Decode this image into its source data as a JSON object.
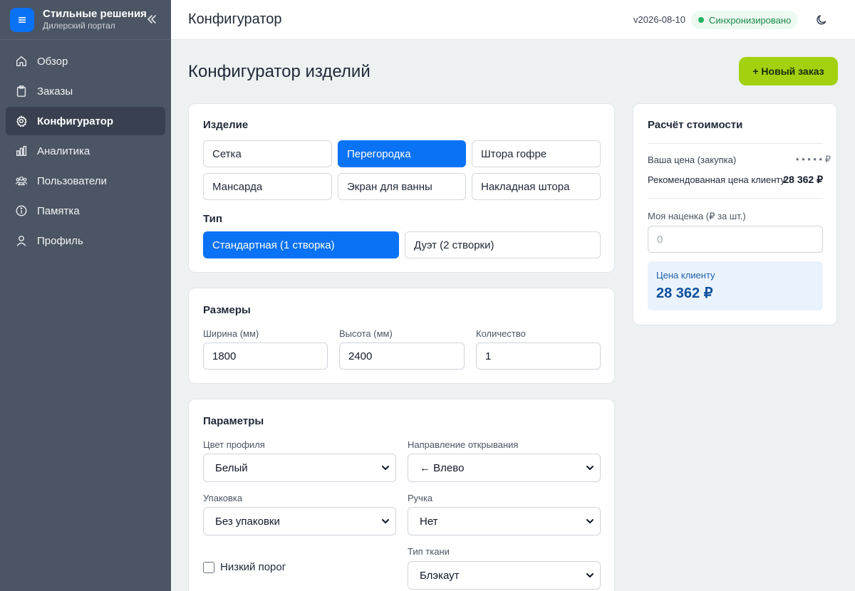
{
  "brand": {
    "name": "Стильные решения",
    "subtitle": "Дилерский портал"
  },
  "sidebar": {
    "items": [
      {
        "label": "Обзор",
        "icon": "home-icon",
        "active": false
      },
      {
        "label": "Заказы",
        "icon": "clipboard-icon",
        "active": false
      },
      {
        "label": "Конфигуратор",
        "icon": "gear-icon",
        "active": true
      },
      {
        "label": "Аналитика",
        "icon": "bar-chart-icon",
        "active": false
      },
      {
        "label": "Пользователи",
        "icon": "users-icon",
        "active": false
      },
      {
        "label": "Памятка",
        "icon": "info-icon",
        "active": false
      },
      {
        "label": "Профиль",
        "icon": "user-icon",
        "active": false
      }
    ]
  },
  "header": {
    "title": "Конфигуратор",
    "version": "v2026-08-10",
    "sync_status": "Синхронизировано"
  },
  "main": {
    "page_title": "Конфигуратор изделий",
    "new_order_label": "+ Новый заказ"
  },
  "product": {
    "title": "Изделие",
    "options": [
      "Сетка",
      "Перегородка",
      "Штора гофре",
      "Мансарда",
      "Экран для ванны",
      "Накладная штора"
    ],
    "selected": "Перегородка",
    "type_title": "Тип",
    "types": [
      "Стандартная (1 створка)",
      "Дуэт (2 створки)"
    ],
    "type_selected": "Стандартная (1 створка)"
  },
  "sizes": {
    "title": "Размеры",
    "width_label": "Ширина (мм)",
    "width_value": "1800",
    "height_label": "Высота (мм)",
    "height_value": "2400",
    "qty_label": "Количество",
    "qty_value": "1"
  },
  "params": {
    "title": "Параметры",
    "profile_color_label": "Цвет профиля",
    "profile_color_value": "Белый",
    "direction_label": "Направление открывания",
    "direction_value": "← Влево",
    "packaging_label": "Упаковка",
    "packaging_value": "Без упаковки",
    "handle_label": "Ручка",
    "handle_value": "Нет",
    "low_threshold_label": "Низкий порог",
    "low_threshold_checked": false,
    "fabric_label": "Тип ткани",
    "fabric_value": "Блэкаут"
  },
  "pricing": {
    "title": "Расчёт стоимости",
    "your_price_label": "Ваша цена (закупка)",
    "your_price_value": "• • • • • ₽",
    "recommended_label": "Рекомендованная цена клиенту",
    "recommended_value": "28 362 ₽",
    "markup_label": "Моя наценка (₽ за шт.)",
    "markup_placeholder": "0",
    "client_price_label": "Цена клиенту",
    "client_price_value": "28 362 ₽"
  },
  "colors": {
    "sidebar_bg": "#4b5563",
    "accent_blue": "#0a72f5",
    "new_order_green": "#a3d10f",
    "sync_green": "#22b35c"
  }
}
